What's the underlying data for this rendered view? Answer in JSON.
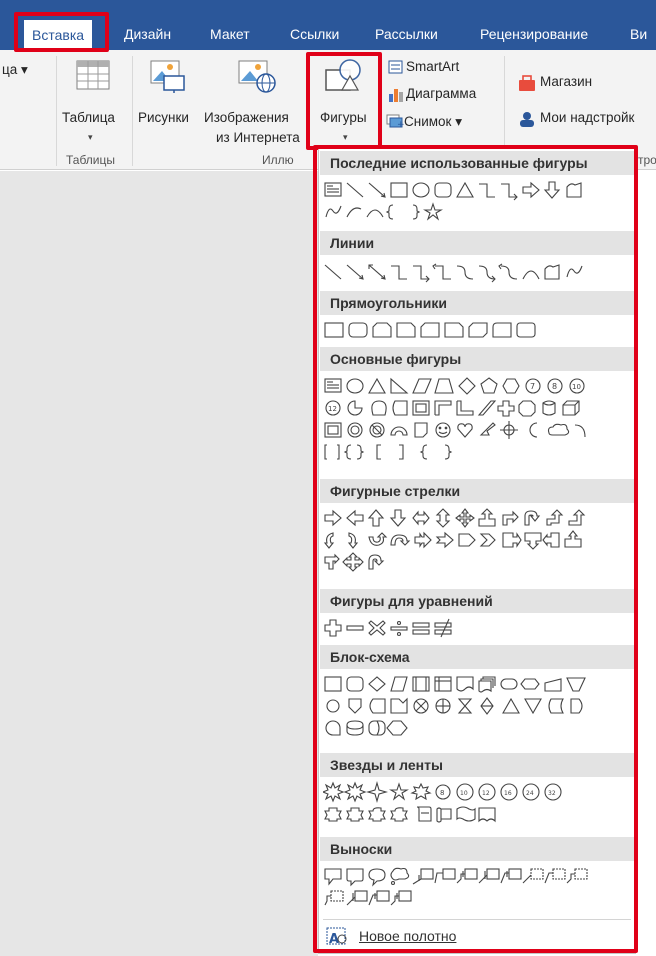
{
  "tabs": [
    {
      "label": "Вставка",
      "active": true
    },
    {
      "label": "Дизайн"
    },
    {
      "label": "Макет"
    },
    {
      "label": "Ссылки"
    },
    {
      "label": "Рассылки"
    },
    {
      "label": "Рецензирование"
    },
    {
      "label": "Ви"
    }
  ],
  "ribbon": {
    "left_clip": "ца",
    "table": {
      "label": "Таблица",
      "group": "Таблицы"
    },
    "pictures": {
      "label": "Рисунки"
    },
    "online_pictures": {
      "label_line1": "Изображения",
      "label_line2": "из Интернета"
    },
    "shapes": {
      "label": "Фигуры"
    },
    "illustrations_group": "Иллю",
    "smartart": {
      "label": "SmartArt"
    },
    "chart": {
      "label": "Диаграмма"
    },
    "screenshot": {
      "label": "Снимок"
    },
    "store": {
      "label": "Магазин"
    },
    "my_addins": {
      "label": "Мои надстройк"
    },
    "addins_group_clip": "тро"
  },
  "menu": {
    "sections": [
      {
        "title": "Последние использованные фигуры"
      },
      {
        "title": "Линии"
      },
      {
        "title": "Прямоугольники"
      },
      {
        "title": "Основные фигуры"
      },
      {
        "title": "Фигурные стрелки"
      },
      {
        "title": "Фигуры для уравнений"
      },
      {
        "title": "Блок-схема"
      },
      {
        "title": "Звезды и ленты"
      },
      {
        "title": "Выноски"
      }
    ],
    "new_canvas": "Новое полотно"
  },
  "colors": {
    "tab_bar": "#2b579a",
    "highlight": "#e00018",
    "section_header": "#e3e3e3",
    "ribbon_bg": "#f3f3f3"
  },
  "icons": [
    "table-icon",
    "pictures-icon",
    "online-pictures-icon",
    "shapes-icon",
    "smartart-icon",
    "chart-icon",
    "screenshot-icon",
    "store-icon",
    "my-addins-icon",
    "new-canvas-icon"
  ]
}
